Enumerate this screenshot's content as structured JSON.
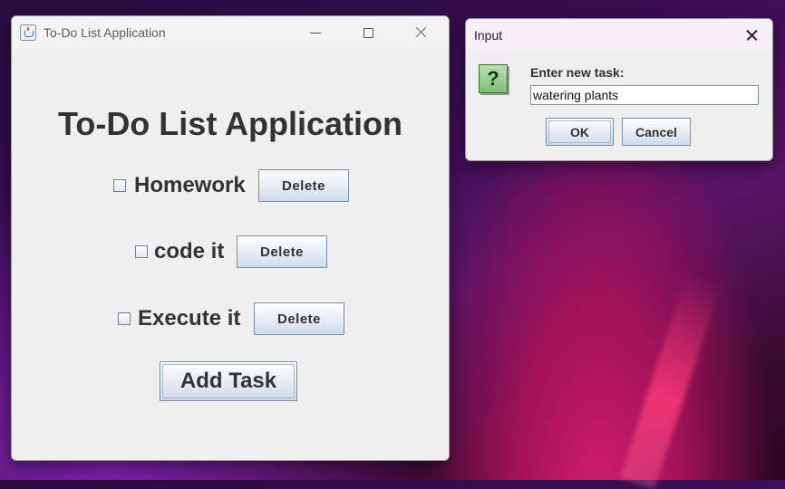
{
  "main_window": {
    "title": "To-Do List Application",
    "heading": "To-Do List Application",
    "tasks": [
      {
        "label": "Homework",
        "checked": false,
        "delete_label": "Delete"
      },
      {
        "label": "code it",
        "checked": false,
        "delete_label": "Delete"
      },
      {
        "label": "Execute it",
        "checked": false,
        "delete_label": "Delete"
      }
    ],
    "add_button_label": "Add Task"
  },
  "dialog": {
    "title": "Input",
    "prompt": "Enter new task:",
    "input_value": "watering plants",
    "ok_label": "OK",
    "cancel_label": "Cancel",
    "icon": "question-icon",
    "icon_glyph": "?"
  },
  "colors": {
    "window_bg": "#efefef",
    "text": "#333333",
    "button_border": "#7a8ea9",
    "question_icon_green": "#7fbf75"
  }
}
